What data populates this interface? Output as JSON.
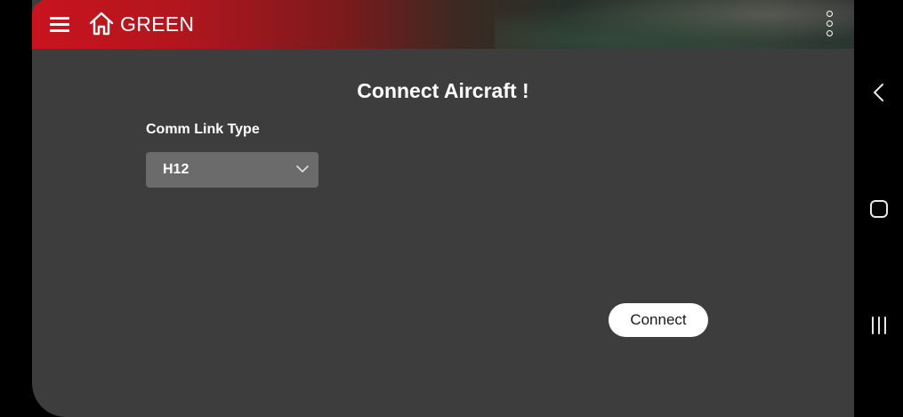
{
  "app": {
    "title": "GREEN",
    "icons": {
      "menu": "hamburger-menu-icon",
      "home": "home-icon",
      "overflow": "vertical-dots-icon"
    },
    "accent_color": "#c8141e"
  },
  "main": {
    "heading": "Connect Aircraft !",
    "comm_link": {
      "label": "Comm Link Type",
      "selected": "H12"
    },
    "connect_label": "Connect"
  },
  "system_nav": {
    "buttons": [
      "back",
      "home",
      "recents"
    ]
  }
}
